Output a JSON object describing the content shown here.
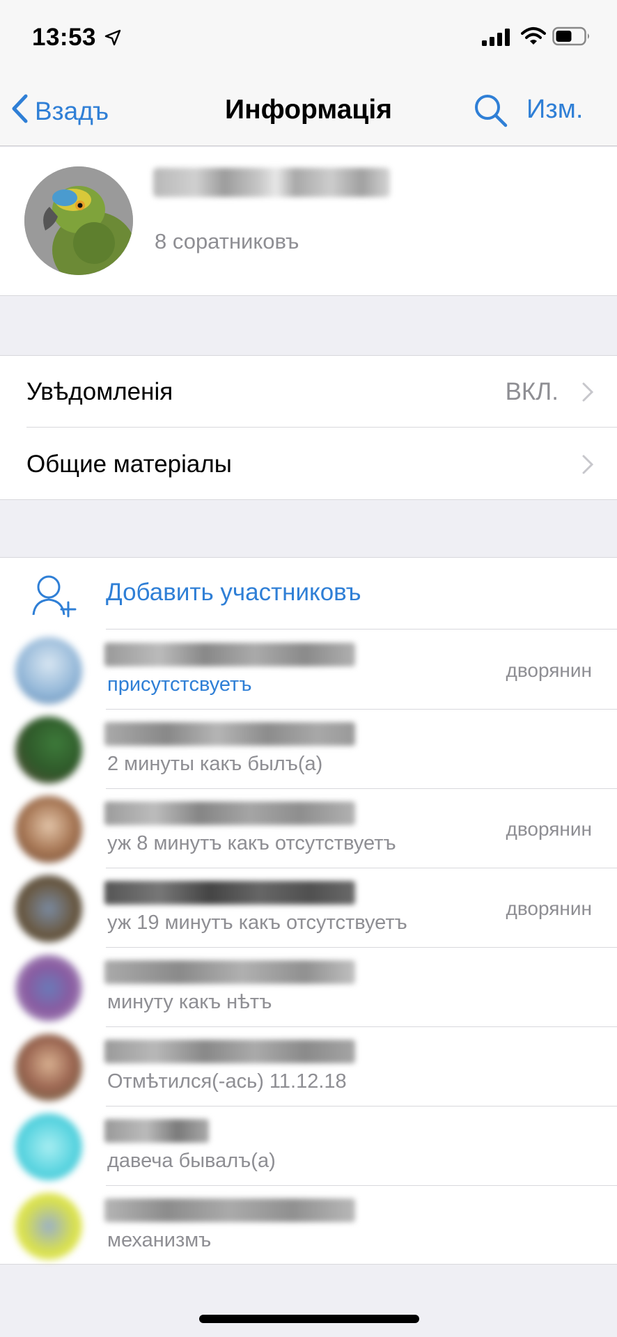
{
  "status_bar": {
    "time": "13:53",
    "icons": [
      "location-arrow-icon",
      "cellular-signal-icon",
      "wifi-icon",
      "battery-icon"
    ]
  },
  "nav": {
    "back_label": "Взадъ",
    "title": "Информація",
    "edit_label": "Изм.",
    "accent_color": "#2f7fd6"
  },
  "profile": {
    "name_blurred": true,
    "subtitle": "8 соратниковъ"
  },
  "settings": {
    "notifications_label": "Увѣдомленія",
    "notifications_value": "ВКЛ.",
    "shared_media_label": "Общие матеріалы"
  },
  "members": {
    "add_label": "Добавить участниковъ",
    "list": [
      {
        "status": "присутстсвуетъ",
        "online": true,
        "role": "дворянин"
      },
      {
        "status": "2 минуты какъ былъ(а)",
        "online": false,
        "role": ""
      },
      {
        "status": "уж 8 минутъ какъ отсутствуетъ",
        "online": false,
        "role": "дворянин"
      },
      {
        "status": "уж 19 минутъ какъ отсутствуетъ",
        "online": false,
        "role": "дворянин"
      },
      {
        "status": "минуту какъ нѣтъ",
        "online": false,
        "role": ""
      },
      {
        "status": "Отмѣтился(-ась) 11.12.18",
        "online": false,
        "role": ""
      },
      {
        "status": "давеча бывалъ(а)",
        "online": false,
        "role": ""
      },
      {
        "status": "механизмъ",
        "online": false,
        "role": ""
      }
    ]
  }
}
